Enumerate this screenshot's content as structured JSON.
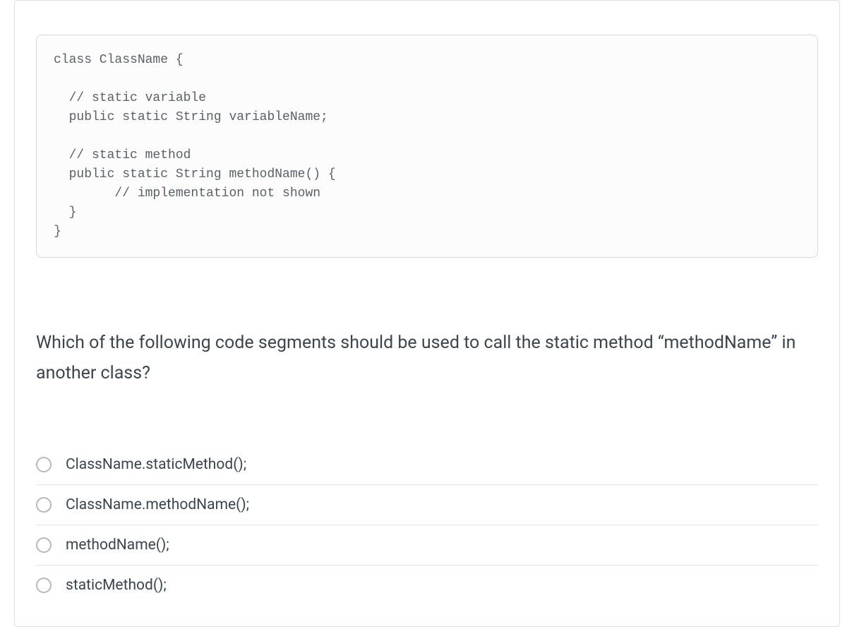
{
  "code": "class ClassName {\n\n  // static variable\n  public static String variableName;\n\n  // static method\n  public static String methodName() {\n        // implementation not shown\n  }\n}",
  "question": "Which of the following code segments should be used to call the static method “methodName” in another class?",
  "options": [
    {
      "label": "ClassName.staticMethod();"
    },
    {
      "label": "ClassName.methodName();"
    },
    {
      "label": "methodName();"
    },
    {
      "label": "staticMethod();"
    }
  ]
}
